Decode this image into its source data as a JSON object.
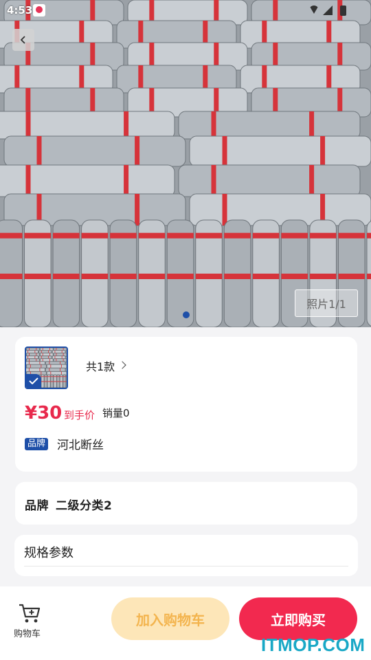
{
  "status_bar": {
    "time": "4:53"
  },
  "gallery": {
    "photo_counter": "照片1/1"
  },
  "product": {
    "variant_count": "共1款",
    "price": "¥30",
    "price_note": "到手价",
    "sales": "销量0",
    "brand_tag": "品牌",
    "brand_name": "河北断丝"
  },
  "attributes": {
    "label": "品牌",
    "value": "二级分类2"
  },
  "spec": {
    "title": "规格参数"
  },
  "bottom_bar": {
    "cart_label": "购物车",
    "add_to_cart": "加入购物车",
    "buy_now": "立即购买"
  },
  "watermark": "ITMOP.COM",
  "colors": {
    "accent_red": "#f2294f",
    "brand_blue": "#1e4fa8",
    "cart_button_bg": "#fde6b8"
  }
}
